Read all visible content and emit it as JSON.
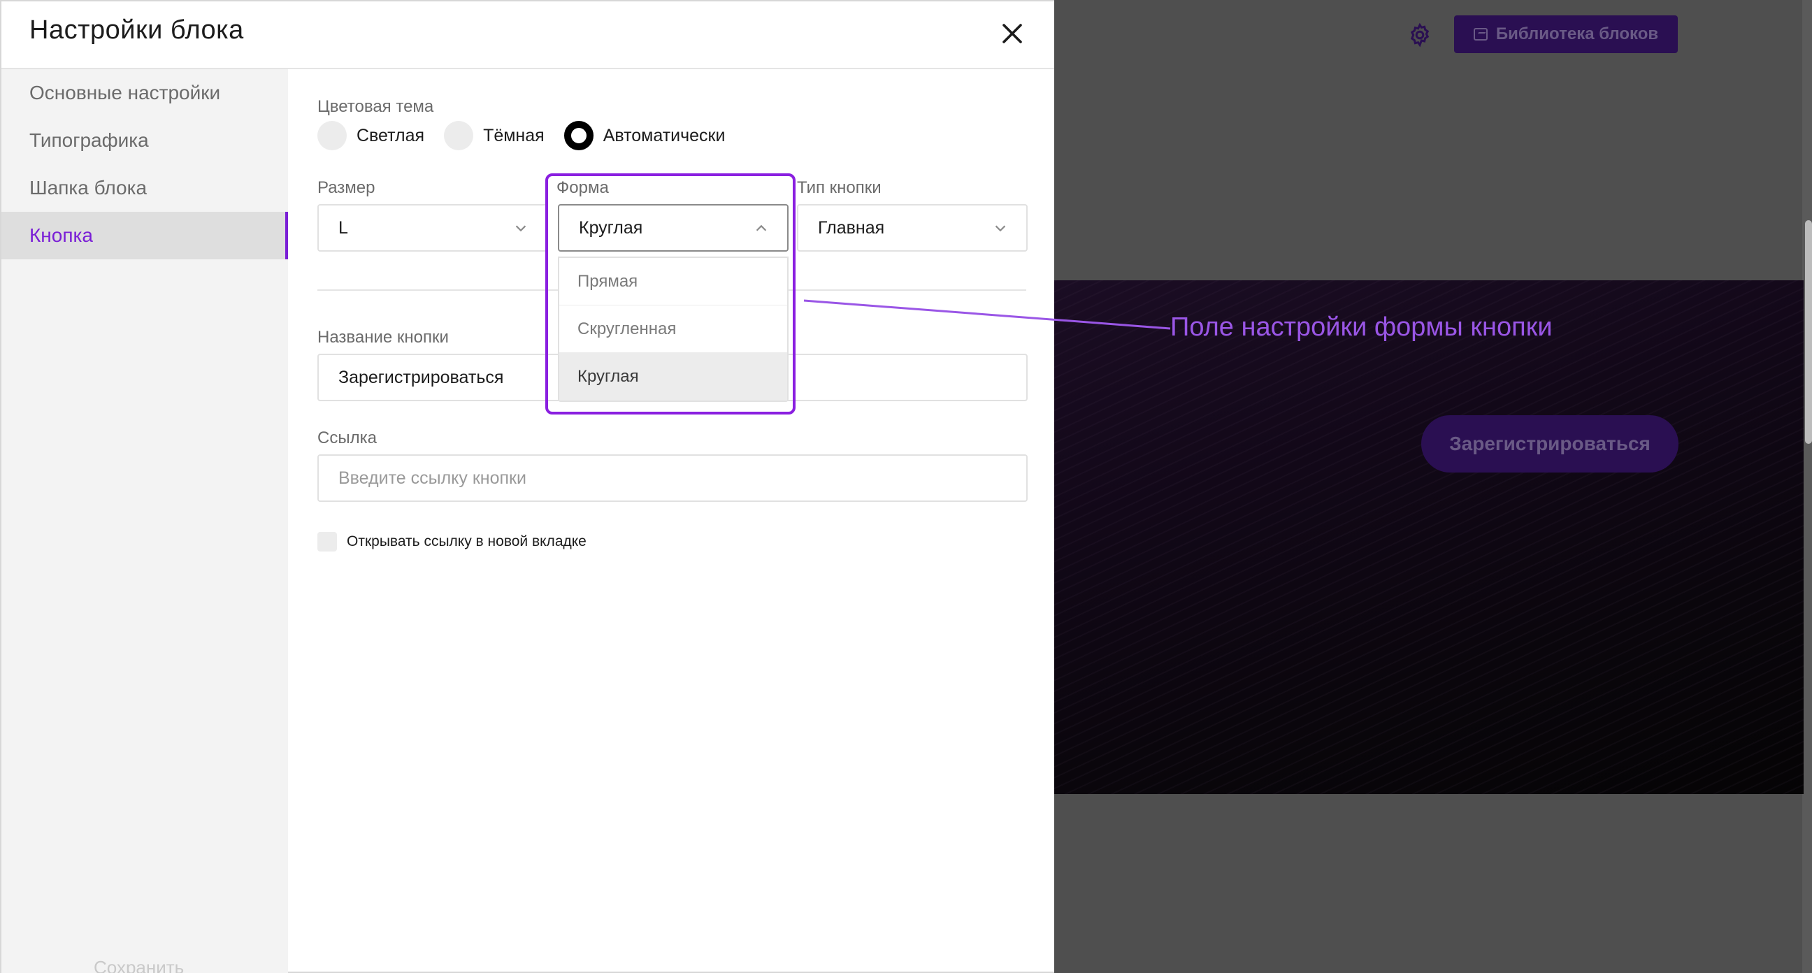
{
  "topbar": {
    "gear_icon": "gear-icon",
    "library_button": "Библиотека блоков"
  },
  "hero": {
    "cta_label": "Зарегистрироваться"
  },
  "panel": {
    "title": "Настройки блока",
    "close_icon": "close-icon"
  },
  "sidebar": {
    "items": [
      {
        "label": "Основные настройки",
        "active": false
      },
      {
        "label": "Типографика",
        "active": false
      },
      {
        "label": "Шапка блока",
        "active": false
      },
      {
        "label": "Кнопка",
        "active": true
      }
    ],
    "save_label": "Сохранить"
  },
  "settings": {
    "theme": {
      "label": "Цветовая тема",
      "options": [
        "Светлая",
        "Тёмная",
        "Автоматически"
      ],
      "selected": "Автоматически"
    },
    "size": {
      "label": "Размер",
      "value": "L"
    },
    "shape": {
      "label": "Форма",
      "value": "Круглая",
      "options": [
        "Прямая",
        "Скругленная",
        "Круглая"
      ]
    },
    "button_type": {
      "label": "Тип кнопки",
      "value": "Главная"
    },
    "button_name": {
      "label": "Название кнопки",
      "value": "Зарегистрироваться"
    },
    "link": {
      "label": "Ссылка",
      "placeholder": "Введите ссылку кнопки"
    },
    "new_tab": {
      "label": "Открывать ссылку в новой вкладке",
      "checked": false
    }
  },
  "annotation": {
    "text": "Поле настройки формы кнопки",
    "color": "#8a1fe0"
  },
  "colors": {
    "accent": "#7a1fd6",
    "canvas": "#4f4f4f",
    "library_button_bg": "#2a0f52"
  }
}
